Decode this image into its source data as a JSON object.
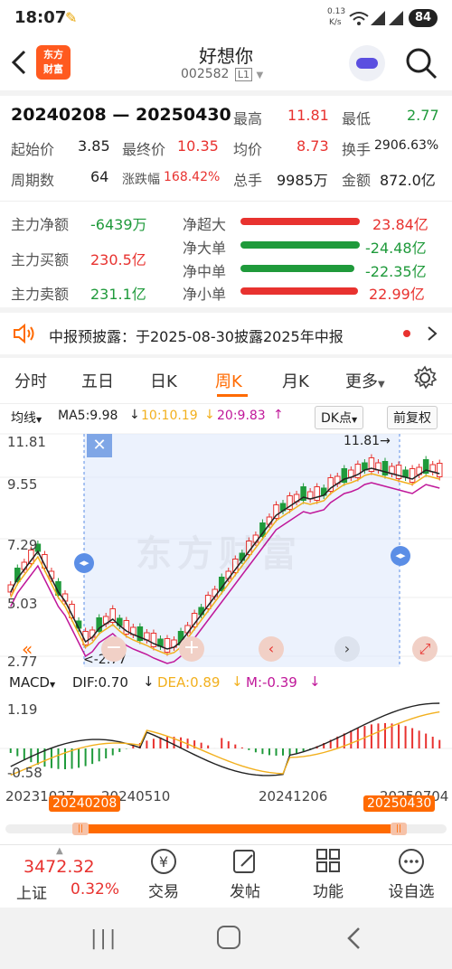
{
  "status_bar": {
    "time": "18:07",
    "net_speed_top": "0.13",
    "net_speed_bottom": "K/s",
    "battery": "84"
  },
  "header": {
    "logo_line1": "东方",
    "logo_line2": "财富",
    "stock_name": "好想你",
    "stock_code": "002582",
    "level_badge": "L1"
  },
  "summary": {
    "date_range": "20240208 — 20250430",
    "rows": [
      [
        {
          "label": "最高",
          "value": "11.81",
          "color": "red"
        },
        {
          "label": "最低",
          "value": "2.77",
          "color": "green"
        }
      ],
      [
        {
          "label": "起始价",
          "value": "3.85",
          "color": "black"
        },
        {
          "label": "最终价",
          "value": "10.35",
          "color": "red"
        },
        {
          "label": "均价",
          "value": "8.73",
          "color": "red"
        },
        {
          "label": "换手",
          "value": "2906.63%",
          "color": "black"
        }
      ],
      [
        {
          "label": "周期数",
          "value": "64",
          "color": "black"
        },
        {
          "label": "涨跌幅",
          "value": "168.42%",
          "color": "red"
        },
        {
          "label": "总手",
          "value": "9985万",
          "color": "black"
        },
        {
          "label": "金额",
          "value": "872.0亿",
          "color": "black"
        }
      ]
    ]
  },
  "fund_flow": {
    "left": [
      {
        "label": "主力净额",
        "value": "-6439万",
        "color": "green"
      },
      {
        "label": "主力买额",
        "value": "230.5亿",
        "color": "red"
      },
      {
        "label": "主力卖额",
        "value": "231.1亿",
        "color": "green"
      }
    ],
    "right": [
      {
        "label": "净超大",
        "value": "23.84亿",
        "color": "red"
      },
      {
        "label": "净大单",
        "value": "-24.48亿",
        "color": "green"
      },
      {
        "label": "净中单",
        "value": "-22.35亿",
        "color": "green"
      },
      {
        "label": "净小单",
        "value": "22.99亿",
        "color": "red"
      }
    ]
  },
  "notice": {
    "text": "中报预披露：于2025-08-30披露2025年中报"
  },
  "tabs": [
    "分时",
    "五日",
    "日K",
    "周K",
    "月K",
    "更多"
  ],
  "active_tab": "周K",
  "chart_toolbar": {
    "indicator": "均线",
    "ma5": "MA5:9.98",
    "ma10": "10:10.19",
    "ma20": "20:9.83",
    "dk": "DK点",
    "adjust": "前复权"
  },
  "kline_axis": {
    "y_labels": [
      "11.81",
      "9.55",
      "7.29",
      "5.03",
      "2.77"
    ],
    "max_label": "11.81",
    "min_label": "2.77",
    "x_labels": [
      "20231027",
      "20240510",
      "20241206",
      "20250704"
    ],
    "range_start": "20240208",
    "range_end": "20250430",
    "watermark": "东方财富"
  },
  "macd": {
    "name": "MACD",
    "dif": "DIF:0.70",
    "dea": "DEA:0.89",
    "m": "M:-0.39",
    "y_top": "1.19",
    "y_bottom": "-0.58"
  },
  "colors": {
    "up": "#e8322f",
    "down": "#1f9a3b",
    "accent": "#ff6a00",
    "ma5": "#222222",
    "ma10": "#f2b01e",
    "ma20": "#c0189a"
  },
  "bottom_bar": {
    "index_value": "3472.32",
    "index_name": "上证",
    "index_change": "0.32%",
    "items": [
      "交易",
      "发帖",
      "功能",
      "设自选"
    ]
  }
}
